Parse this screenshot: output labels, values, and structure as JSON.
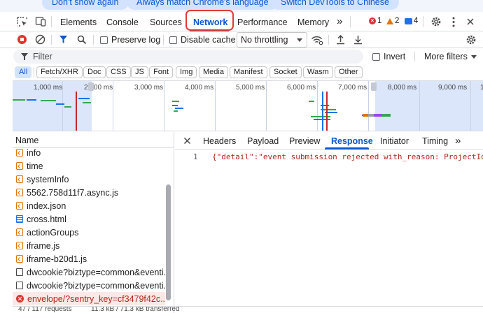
{
  "banner": {
    "buttons": [
      "Don't show again",
      "Always match Chrome's language",
      "Switch DevTools to Chinese"
    ]
  },
  "main_tabs": {
    "items": [
      "Elements",
      "Console",
      "Sources",
      "Network",
      "Performance",
      "Memory"
    ],
    "active": "Network",
    "more_label": "»"
  },
  "issues": {
    "errors": "1",
    "warnings": "2",
    "info": "4"
  },
  "toolbar": {
    "preserve_log": "Preserve log",
    "disable_cache": "Disable cache",
    "throttling": "No throttling"
  },
  "filter": {
    "placeholder": "Filter",
    "invert": "Invert",
    "more_filters": "More filters"
  },
  "type_filters": [
    "All",
    "Fetch/XHR",
    "Doc",
    "CSS",
    "JS",
    "Font",
    "Img",
    "Media",
    "Manifest",
    "Socket",
    "Wasm",
    "Other"
  ],
  "active_type_filter": "All",
  "overview": {
    "ticks": [
      "1,000 ms",
      "2,000 ms",
      "3,000 ms",
      "4,000 ms",
      "5,000 ms",
      "6,000 ms",
      "7,000 ms",
      "8,000 ms",
      "9,000 ms",
      "1"
    ]
  },
  "request_list": {
    "header": "Name",
    "rows": [
      {
        "name": "info",
        "type": "js"
      },
      {
        "name": "time",
        "type": "js"
      },
      {
        "name": "systemInfo",
        "type": "js"
      },
      {
        "name": "5562.758d11f7.async.js",
        "type": "js"
      },
      {
        "name": "index.json",
        "type": "js"
      },
      {
        "name": "cross.html",
        "type": "doc"
      },
      {
        "name": "actionGroups",
        "type": "js"
      },
      {
        "name": "iframe.js",
        "type": "js"
      },
      {
        "name": "iframe-b20d1.js",
        "type": "js"
      },
      {
        "name": "dwcookie?biztype=common&eventi...",
        "type": "file"
      },
      {
        "name": "dwcookie?biztype=common&eventi...",
        "type": "file"
      },
      {
        "name": "envelope/?sentry_key=cf3479f42c...",
        "type": "error"
      }
    ]
  },
  "status_bar": {
    "requests": "47 / 117 requests",
    "transferred": "11.3 kB / 71.3 kB transferred"
  },
  "detail": {
    "tabs": [
      "Headers",
      "Payload",
      "Preview",
      "Response",
      "Initiator",
      "Timing"
    ],
    "active": "Response",
    "more_label": "»",
    "line_number": "1",
    "response_body": "{\"detail\":\"event submission rejected with_reason: ProjectId\"}"
  },
  "colors": {
    "accent": "#0b57d0",
    "error": "#dc362e",
    "warning": "#e37400",
    "highlight_outline": "#e53935"
  }
}
